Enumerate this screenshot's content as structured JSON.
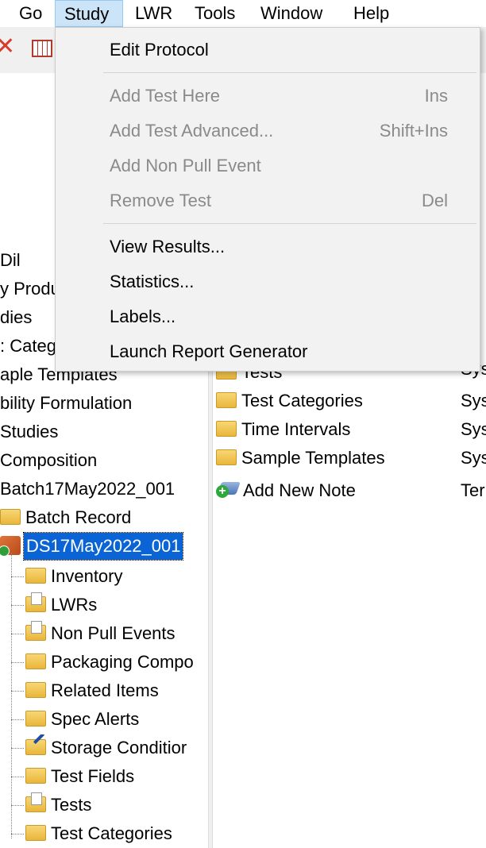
{
  "menubar": {
    "items": [
      "Go",
      "Study",
      "LWR",
      "Tools",
      "Window",
      "Help"
    ]
  },
  "menu": {
    "items": [
      {
        "label": "Edit Protocol",
        "shortcut": "",
        "enabled": true
      },
      {
        "label": "Add Test Here",
        "shortcut": "Ins",
        "enabled": false
      },
      {
        "label": "Add Test Advanced...",
        "shortcut": "Shift+Ins",
        "enabled": false
      },
      {
        "label": "Add Non Pull Event",
        "shortcut": "",
        "enabled": false
      },
      {
        "label": "Remove Test",
        "shortcut": "Del",
        "enabled": false
      },
      {
        "label": "View Results...",
        "shortcut": "",
        "enabled": true
      },
      {
        "label": "Statistics...",
        "shortcut": "",
        "enabled": true
      },
      {
        "label": "Labels...",
        "shortcut": "",
        "enabled": true
      },
      {
        "label": "Launch Report Generator",
        "shortcut": "",
        "enabled": true
      }
    ]
  },
  "tree": {
    "top_items": [
      "Dil",
      "y Produ",
      "dies",
      ": Categ",
      "aple Templates",
      "bility Formulation",
      "Studies",
      "Composition",
      "Batch17May2022_001"
    ],
    "batch_record": "Batch Record",
    "selected_study": "DS17May2022_001",
    "children": [
      "Inventory",
      "LWRs",
      "Non Pull Events",
      "Packaging Compo",
      "Related Items",
      "Spec Alerts",
      "Storage Conditior",
      "Test Fields",
      "Tests",
      "Test Categories"
    ]
  },
  "right_panel": {
    "cut_top": "Tests",
    "items": [
      {
        "label": "Test Categories",
        "type": "Sys"
      },
      {
        "label": "Time Intervals",
        "type": "Sys"
      },
      {
        "label": "Sample Templates",
        "type": "Sys"
      },
      {
        "label": "Add New Note",
        "type": "Ter"
      }
    ],
    "type_column_fragments": [
      "p",
      "s",
      "s",
      "s",
      "s",
      "s",
      "s",
      "s",
      "s",
      "s",
      "Sys"
    ]
  },
  "colors": {
    "selection": "#0a64d6",
    "menu_bg": "#f2f2f2",
    "menu_active": "#cce4f7",
    "disabled_text": "#8a8a8a"
  }
}
